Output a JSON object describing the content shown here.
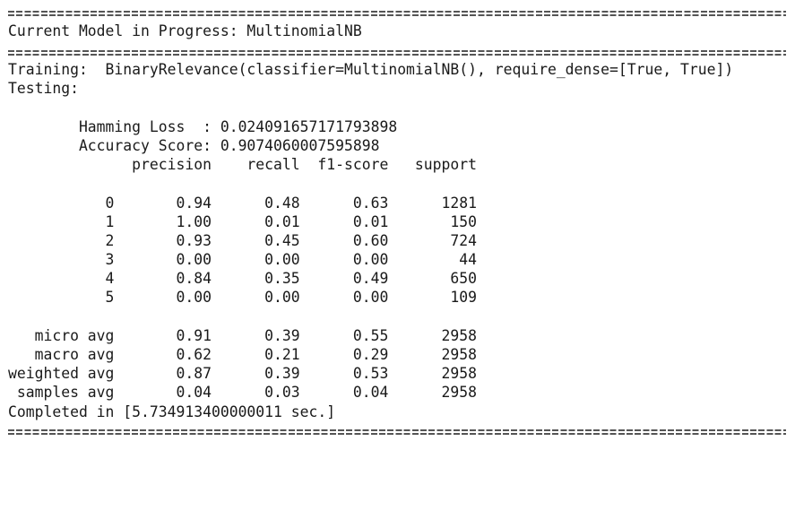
{
  "header": {
    "rule_text": "====================================================================================",
    "current_model": "Current Model in Progress: MultinomialNB"
  },
  "run": {
    "training": "Training:  BinaryRelevance(classifier=MultinomialNB(), require_dense=[True, True])",
    "testing": "Testing:"
  },
  "metrics": {
    "hamming_loss": "        Hamming Loss  : 0.024091657171793898",
    "accuracy_score": "        Accuracy Score: 0.9074060007595898"
  },
  "report": {
    "header": "              precision    recall  f1-score   support",
    "rows": [
      "           0       0.94      0.48      0.63      1281",
      "           1       1.00      0.01      0.01       150",
      "           2       0.93      0.45      0.60       724",
      "           3       0.00      0.00      0.00        44",
      "           4       0.84      0.35      0.49       650",
      "           5       0.00      0.00      0.00       109"
    ],
    "averages": [
      "   micro avg       0.91      0.39      0.55      2958",
      "   macro avg       0.62      0.21      0.29      2958",
      "weighted avg       0.87      0.39      0.53      2958",
      " samples avg       0.04      0.03      0.04      2958"
    ]
  },
  "footer": {
    "completed": "Completed in [5.734913400000011 sec.]"
  }
}
